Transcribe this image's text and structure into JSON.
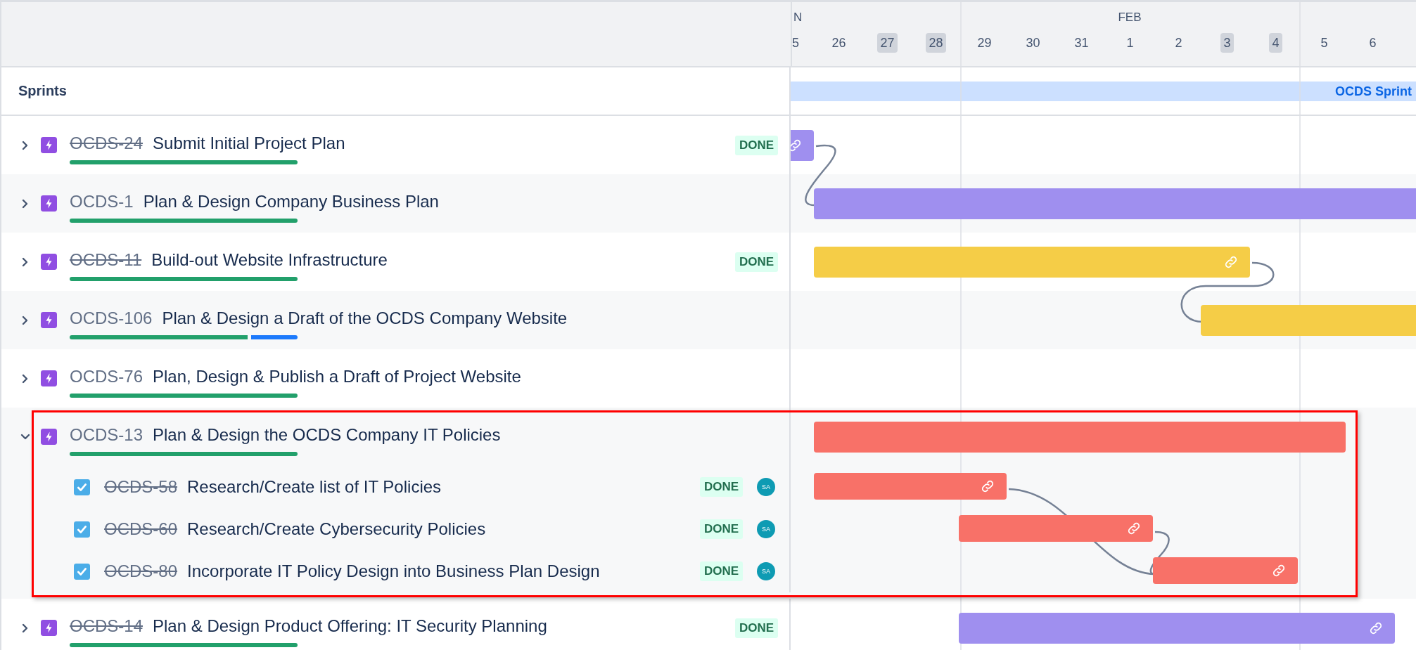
{
  "header": {
    "months": [
      {
        "label": "N"
      },
      {
        "label": "FEB"
      }
    ],
    "days": [
      {
        "label": "5",
        "weekend": false
      },
      {
        "label": "26",
        "weekend": false
      },
      {
        "label": "27",
        "weekend": true
      },
      {
        "label": "28",
        "weekend": true
      },
      {
        "label": "29",
        "weekend": false
      },
      {
        "label": "30",
        "weekend": false
      },
      {
        "label": "31",
        "weekend": false
      },
      {
        "label": "1",
        "weekend": false
      },
      {
        "label": "2",
        "weekend": false
      },
      {
        "label": "3",
        "weekend": true
      },
      {
        "label": "4",
        "weekend": true
      },
      {
        "label": "5",
        "weekend": false
      },
      {
        "label": "6",
        "weekend": false
      }
    ]
  },
  "sprints": {
    "label": "Sprints",
    "sprint_bar": "OCDS Sprint"
  },
  "issues": [
    {
      "key": "OCDS-24",
      "title": "Submit Initial Project Plan",
      "resolved": true,
      "expanded": false,
      "status": "DONE",
      "in_progress": false,
      "bar": {
        "color": "#9f8fef",
        "linked": true
      }
    },
    {
      "key": "OCDS-1",
      "title": "Plan & Design Company Business Plan",
      "resolved": false,
      "expanded": false,
      "in_progress": false,
      "bar": {
        "color": "#9f8fef"
      }
    },
    {
      "key": "OCDS-11",
      "title": "Build-out Website Infrastructure",
      "resolved": true,
      "expanded": false,
      "status": "DONE",
      "in_progress": false,
      "bar": {
        "color": "#f5cd47",
        "linked": true
      }
    },
    {
      "key": "OCDS-106",
      "title": "Plan & Design a Draft of the OCDS Company Website",
      "resolved": false,
      "expanded": false,
      "in_progress": true,
      "bar": {
        "color": "#f5cd47"
      }
    },
    {
      "key": "OCDS-76",
      "title": "Plan, Design & Publish a Draft of Project Website",
      "resolved": false,
      "expanded": false,
      "in_progress": false
    },
    {
      "key": "OCDS-13",
      "title": "Plan & Design the OCDS Company IT Policies",
      "resolved": false,
      "expanded": true,
      "in_progress": false,
      "bar": {
        "color": "#f87168",
        "linked": false
      },
      "children": [
        {
          "key": "OCDS-58",
          "title": "Research/Create list of IT Policies",
          "resolved": true,
          "status": "DONE",
          "assignee": "SA",
          "bar": {
            "color": "#f87168",
            "linked": true
          }
        },
        {
          "key": "OCDS-60",
          "title": "Research/Create Cybersecurity Policies",
          "resolved": true,
          "status": "DONE",
          "assignee": "SA",
          "bar": {
            "color": "#f87168",
            "linked": true
          }
        },
        {
          "key": "OCDS-80",
          "title": "Incorporate IT Policy Design into Business Plan Design",
          "resolved": true,
          "status": "DONE",
          "assignee": "SA",
          "bar": {
            "color": "#f87168",
            "linked": true
          }
        }
      ]
    },
    {
      "key": "OCDS-14",
      "title": "Plan & Design Product Offering: IT Security Planning",
      "resolved": true,
      "expanded": false,
      "status": "DONE",
      "in_progress": false,
      "bar": {
        "color": "#9f8fef",
        "linked": true
      }
    }
  ]
}
